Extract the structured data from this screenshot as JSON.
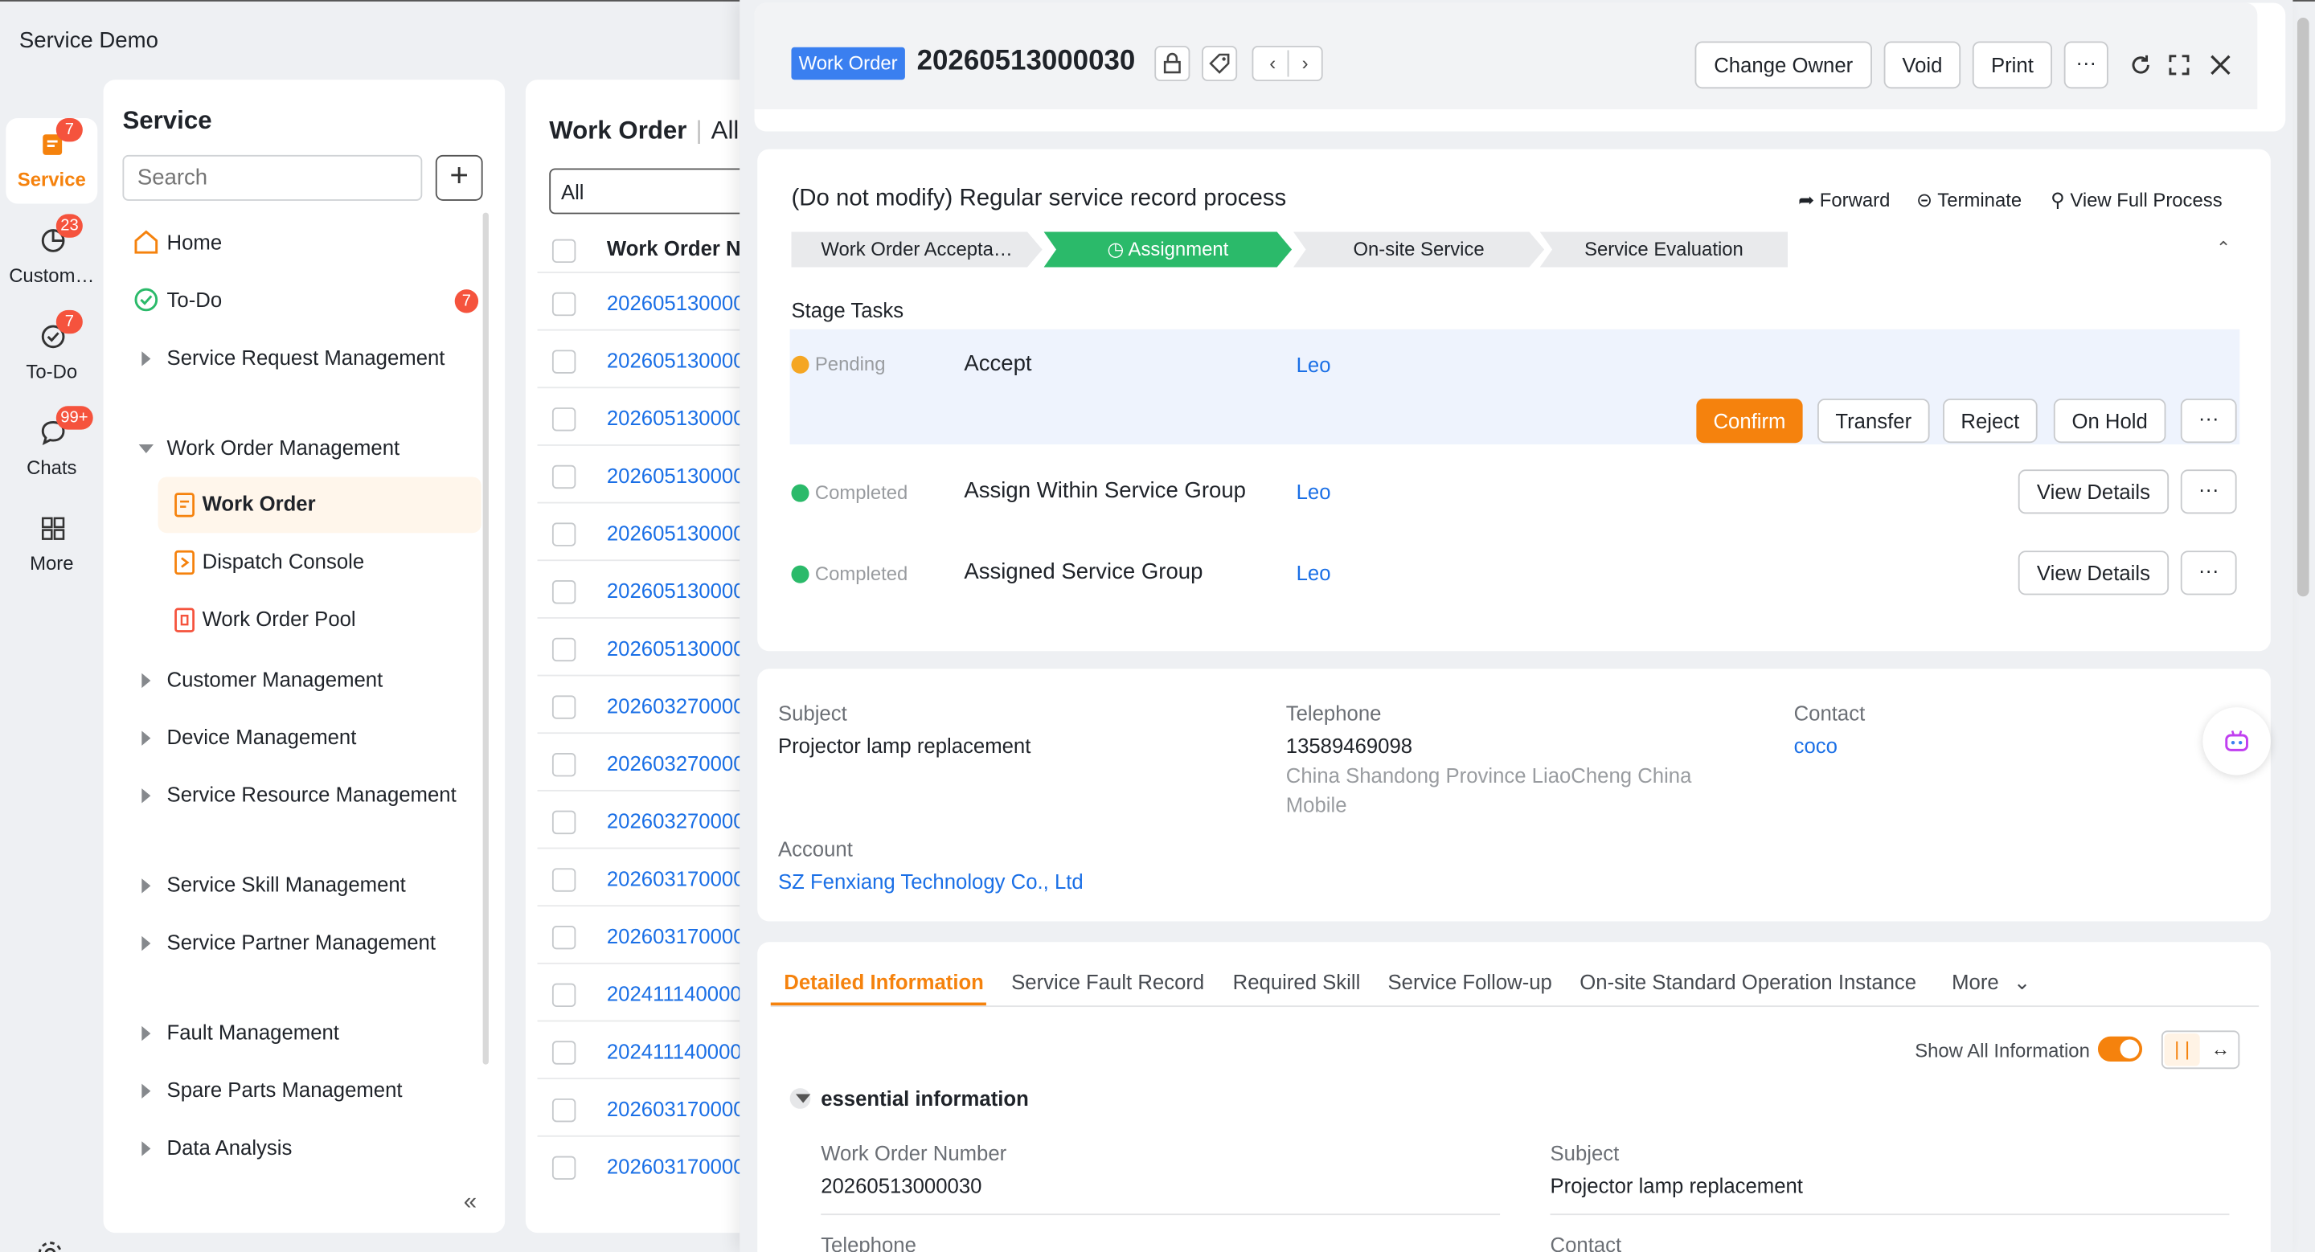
{
  "app": {
    "title": "Service Demo"
  },
  "rail": {
    "items": [
      {
        "label": "Service",
        "badge": "7",
        "icon": "service-icon"
      },
      {
        "label": "Custom…",
        "badge": "23",
        "icon": "customer-pie-icon"
      },
      {
        "label": "To-Do",
        "badge": "7",
        "icon": "todo-check-icon"
      },
      {
        "label": "Chats",
        "badge": "99+",
        "icon": "chat-bubble-icon"
      },
      {
        "label": "More",
        "badge": "",
        "icon": "grid-icon"
      }
    ],
    "settings_icon": "gear-icon"
  },
  "nav": {
    "title": "Service",
    "search_placeholder": "Search",
    "add_label": "+",
    "items": [
      {
        "label": "Home"
      },
      {
        "label": "To-Do",
        "badge": "7"
      },
      {
        "label": "Service Request Management"
      },
      {
        "label": "Work Order Management"
      },
      {
        "label": "Customer Management"
      },
      {
        "label": "Device Management"
      },
      {
        "label": "Service Resource Management"
      },
      {
        "label": "Service Skill Management"
      },
      {
        "label": "Service Partner Management"
      },
      {
        "label": "Fault Management"
      },
      {
        "label": "Spare Parts Management"
      },
      {
        "label": "Data Analysis"
      }
    ],
    "subitems": [
      {
        "label": "Work Order"
      },
      {
        "label": "Dispatch Console"
      },
      {
        "label": "Work Order Pool"
      }
    ],
    "collapse_label": "«"
  },
  "list": {
    "title": "Work Order",
    "view": "All",
    "filter_value": "All",
    "column_header": "Work Order N",
    "rows": [
      "202605130000",
      "202605130000",
      "202605130000",
      "202605130000",
      "202605130000",
      "202605130000",
      "202605130000",
      "202603270000",
      "202603270000",
      "202603270000",
      "202603170000",
      "202603170000",
      "202411140000",
      "202411140000",
      "202603170000",
      "202603170000"
    ]
  },
  "detail": {
    "tag": "Work Order",
    "number": "20260513000030",
    "actions": {
      "change_owner": "Change Owner",
      "void": "Void",
      "print": "Print",
      "more": "···"
    },
    "process": {
      "title": "(Do not modify) Regular service record process",
      "forward": "Forward",
      "terminate": "Terminate",
      "view_full": "View Full Process",
      "stages": [
        {
          "label": "Work Order Accepta…"
        },
        {
          "label": "Assignment"
        },
        {
          "label": "On-site Service"
        },
        {
          "label": "Service Evaluation"
        }
      ],
      "tasks_label": "Stage Tasks",
      "tasks": [
        {
          "status": "Pending",
          "name": "Accept",
          "owner": "Leo"
        },
        {
          "status": "Completed",
          "name": "Assign Within Service Group",
          "owner": "Leo"
        },
        {
          "status": "Completed",
          "name": "Assigned Service Group",
          "owner": "Leo"
        }
      ],
      "task_buttons": {
        "confirm": "Confirm",
        "transfer": "Transfer",
        "reject": "Reject",
        "on_hold": "On Hold",
        "more": "···",
        "view_details": "View Details"
      }
    },
    "summary": {
      "subject_label": "Subject",
      "subject": "Projector lamp replacement",
      "telephone_label": "Telephone",
      "telephone": "13589469098",
      "telephone_location": "China Shandong Province LiaoCheng China Mobile",
      "contact_label": "Contact",
      "contact": "coco",
      "account_label": "Account",
      "account": "SZ Fenxiang Technology Co., Ltd"
    },
    "tabs": [
      "Detailed Information",
      "Service Fault Record",
      "Required Skill",
      "Service Follow-up",
      "On-site Standard Operation Instance",
      "More"
    ],
    "show_all_label": "Show All Information",
    "section_title": "essential information",
    "fields": {
      "work_order_number_label": "Work Order Number",
      "work_order_number": "20260513000030",
      "subject_label": "Subject",
      "subject": "Projector lamp replacement",
      "telephone_label": "Telephone",
      "contact_label": "Contact"
    }
  },
  "colors": {
    "accent": "#f5820d",
    "link": "#1a6fe6",
    "success": "#2bba6a",
    "badge": "#f5533d",
    "tag": "#3a7ff0"
  }
}
